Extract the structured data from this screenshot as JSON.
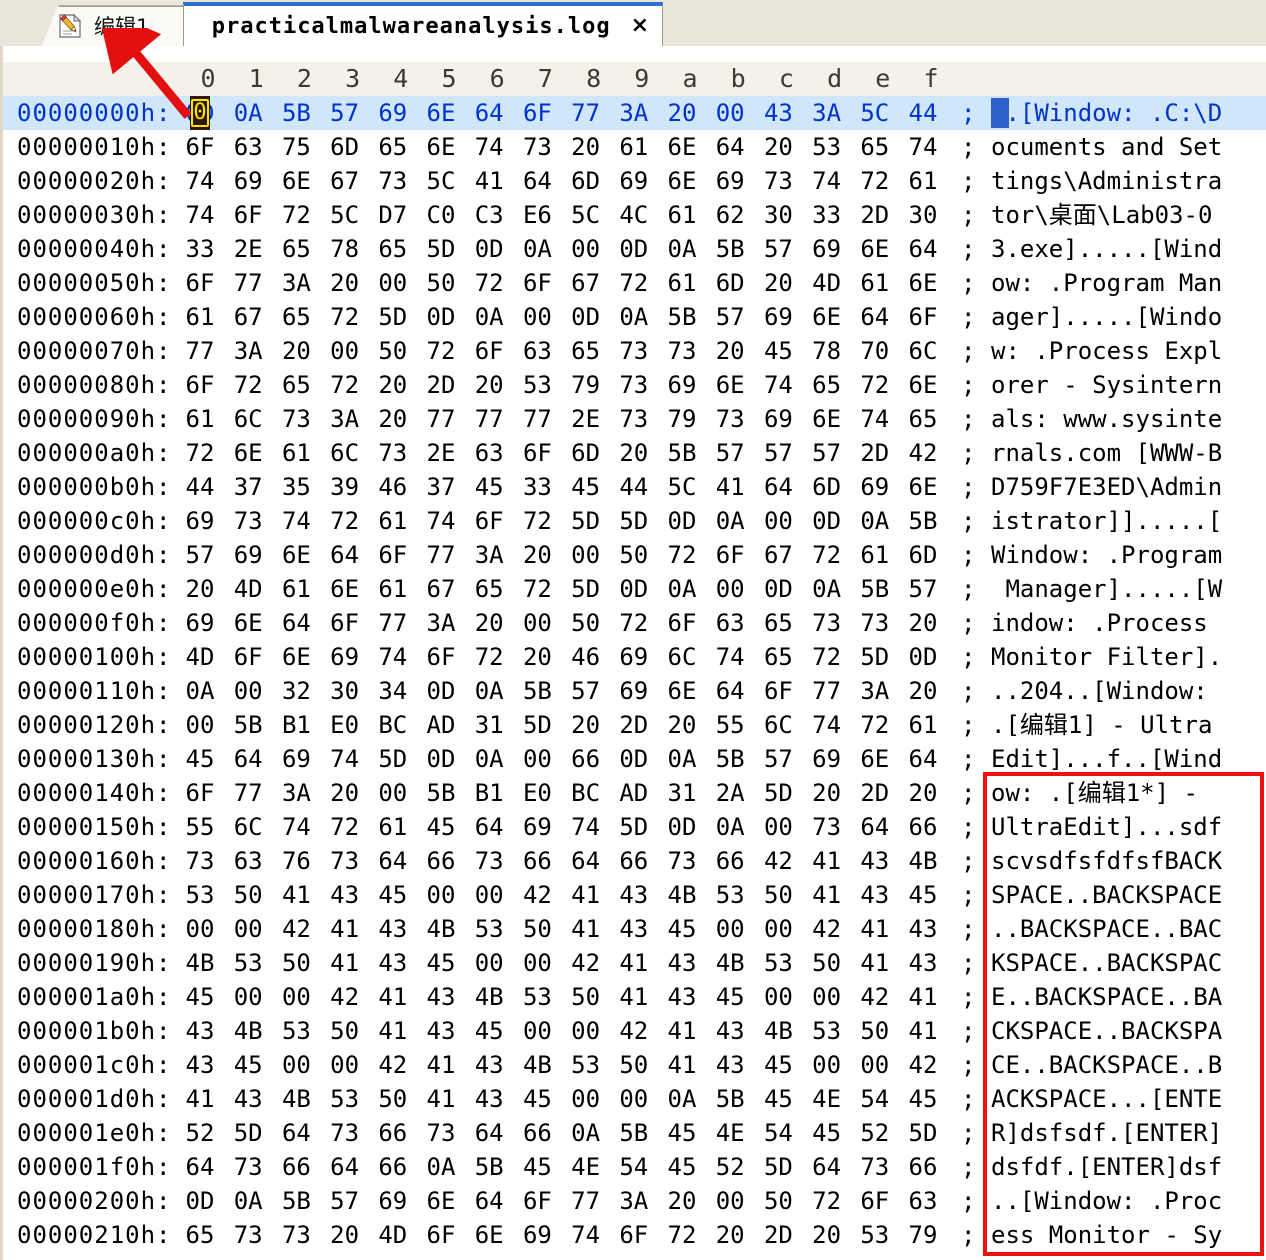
{
  "window": {
    "app": "UltraEdit hex view"
  },
  "tabs": [
    {
      "label": "编辑1",
      "icon": "document-pencil-icon",
      "active": false,
      "closable": false
    },
    {
      "label": "practicalmalwareanalysis.log",
      "icon": "none",
      "active": true,
      "closable": true,
      "close_label": "×"
    }
  ],
  "column_headers": [
    "0",
    "1",
    "2",
    "3",
    "4",
    "5",
    "6",
    "7",
    "8",
    "9",
    "a",
    "b",
    "c",
    "d",
    "e",
    "f"
  ],
  "separator": ";",
  "cursor": {
    "row": 0,
    "col": 0,
    "char": "0",
    "block_color": "#2c1a0a",
    "outline_color": "#ffe000"
  },
  "selection": {
    "ascii_row": 0,
    "ascii_col": 0,
    "color": "#2f60c8"
  },
  "annotations": {
    "arrow_color": "#e31010",
    "box_color": "#f01010",
    "arrow_target": "编辑1 tab",
    "box_target": "ascii column rows 0x140-0x210"
  },
  "colors": {
    "selected_row_bg": "#cfe6fb",
    "selected_row_fg": "#0033cc",
    "header_bg": "#f4f1e8",
    "tab_active_accent": "#2f6fd0"
  },
  "rows": [
    {
      "offset": "00000000h:",
      "bytes": [
        "0D",
        "0A",
        "5B",
        "57",
        "69",
        "6E",
        "64",
        "6F",
        "77",
        "3A",
        "20",
        "00",
        "43",
        "3A",
        "5C",
        "44"
      ],
      "ascii": "..[Window: .C:\\D",
      "selected": true
    },
    {
      "offset": "00000010h:",
      "bytes": [
        "6F",
        "63",
        "75",
        "6D",
        "65",
        "6E",
        "74",
        "73",
        "20",
        "61",
        "6E",
        "64",
        "20",
        "53",
        "65",
        "74"
      ],
      "ascii": "ocuments and Set",
      "selected": false
    },
    {
      "offset": "00000020h:",
      "bytes": [
        "74",
        "69",
        "6E",
        "67",
        "73",
        "5C",
        "41",
        "64",
        "6D",
        "69",
        "6E",
        "69",
        "73",
        "74",
        "72",
        "61"
      ],
      "ascii": "tings\\Administra",
      "selected": false
    },
    {
      "offset": "00000030h:",
      "bytes": [
        "74",
        "6F",
        "72",
        "5C",
        "D7",
        "C0",
        "C3",
        "E6",
        "5C",
        "4C",
        "61",
        "62",
        "30",
        "33",
        "2D",
        "30"
      ],
      "ascii": "tor\\桌面\\Lab03-0",
      "selected": false
    },
    {
      "offset": "00000040h:",
      "bytes": [
        "33",
        "2E",
        "65",
        "78",
        "65",
        "5D",
        "0D",
        "0A",
        "00",
        "0D",
        "0A",
        "5B",
        "57",
        "69",
        "6E",
        "64"
      ],
      "ascii": "3.exe].....[Wind",
      "selected": false
    },
    {
      "offset": "00000050h:",
      "bytes": [
        "6F",
        "77",
        "3A",
        "20",
        "00",
        "50",
        "72",
        "6F",
        "67",
        "72",
        "61",
        "6D",
        "20",
        "4D",
        "61",
        "6E"
      ],
      "ascii": "ow: .Program Man",
      "selected": false
    },
    {
      "offset": "00000060h:",
      "bytes": [
        "61",
        "67",
        "65",
        "72",
        "5D",
        "0D",
        "0A",
        "00",
        "0D",
        "0A",
        "5B",
        "57",
        "69",
        "6E",
        "64",
        "6F"
      ],
      "ascii": "ager].....[Windo",
      "selected": false
    },
    {
      "offset": "00000070h:",
      "bytes": [
        "77",
        "3A",
        "20",
        "00",
        "50",
        "72",
        "6F",
        "63",
        "65",
        "73",
        "73",
        "20",
        "45",
        "78",
        "70",
        "6C"
      ],
      "ascii": "w: .Process Expl",
      "selected": false
    },
    {
      "offset": "00000080h:",
      "bytes": [
        "6F",
        "72",
        "65",
        "72",
        "20",
        "2D",
        "20",
        "53",
        "79",
        "73",
        "69",
        "6E",
        "74",
        "65",
        "72",
        "6E"
      ],
      "ascii": "orer - Sysintern",
      "selected": false
    },
    {
      "offset": "00000090h:",
      "bytes": [
        "61",
        "6C",
        "73",
        "3A",
        "20",
        "77",
        "77",
        "77",
        "2E",
        "73",
        "79",
        "73",
        "69",
        "6E",
        "74",
        "65"
      ],
      "ascii": "als: www.sysinte",
      "selected": false
    },
    {
      "offset": "000000a0h:",
      "bytes": [
        "72",
        "6E",
        "61",
        "6C",
        "73",
        "2E",
        "63",
        "6F",
        "6D",
        "20",
        "5B",
        "57",
        "57",
        "57",
        "2D",
        "42"
      ],
      "ascii": "rnals.com [WWW-B",
      "selected": false
    },
    {
      "offset": "000000b0h:",
      "bytes": [
        "44",
        "37",
        "35",
        "39",
        "46",
        "37",
        "45",
        "33",
        "45",
        "44",
        "5C",
        "41",
        "64",
        "6D",
        "69",
        "6E"
      ],
      "ascii": "D759F7E3ED\\Admin",
      "selected": false
    },
    {
      "offset": "000000c0h:",
      "bytes": [
        "69",
        "73",
        "74",
        "72",
        "61",
        "74",
        "6F",
        "72",
        "5D",
        "5D",
        "0D",
        "0A",
        "00",
        "0D",
        "0A",
        "5B"
      ],
      "ascii": "istrator]].....[",
      "selected": false
    },
    {
      "offset": "000000d0h:",
      "bytes": [
        "57",
        "69",
        "6E",
        "64",
        "6F",
        "77",
        "3A",
        "20",
        "00",
        "50",
        "72",
        "6F",
        "67",
        "72",
        "61",
        "6D"
      ],
      "ascii": "Window: .Program",
      "selected": false
    },
    {
      "offset": "000000e0h:",
      "bytes": [
        "20",
        "4D",
        "61",
        "6E",
        "61",
        "67",
        "65",
        "72",
        "5D",
        "0D",
        "0A",
        "00",
        "0D",
        "0A",
        "5B",
        "57"
      ],
      "ascii": " Manager].....[W",
      "selected": false
    },
    {
      "offset": "000000f0h:",
      "bytes": [
        "69",
        "6E",
        "64",
        "6F",
        "77",
        "3A",
        "20",
        "00",
        "50",
        "72",
        "6F",
        "63",
        "65",
        "73",
        "73",
        "20"
      ],
      "ascii": "indow: .Process ",
      "selected": false
    },
    {
      "offset": "00000100h:",
      "bytes": [
        "4D",
        "6F",
        "6E",
        "69",
        "74",
        "6F",
        "72",
        "20",
        "46",
        "69",
        "6C",
        "74",
        "65",
        "72",
        "5D",
        "0D"
      ],
      "ascii": "Monitor Filter].",
      "selected": false
    },
    {
      "offset": "00000110h:",
      "bytes": [
        "0A",
        "00",
        "32",
        "30",
        "34",
        "0D",
        "0A",
        "5B",
        "57",
        "69",
        "6E",
        "64",
        "6F",
        "77",
        "3A",
        "20"
      ],
      "ascii": "..204..[Window: ",
      "selected": false
    },
    {
      "offset": "00000120h:",
      "bytes": [
        "00",
        "5B",
        "B1",
        "E0",
        "BC",
        "AD",
        "31",
        "5D",
        "20",
        "2D",
        "20",
        "55",
        "6C",
        "74",
        "72",
        "61"
      ],
      "ascii": ".[编辑1] - Ultra",
      "selected": false
    },
    {
      "offset": "00000130h:",
      "bytes": [
        "45",
        "64",
        "69",
        "74",
        "5D",
        "0D",
        "0A",
        "00",
        "66",
        "0D",
        "0A",
        "5B",
        "57",
        "69",
        "6E",
        "64"
      ],
      "ascii": "Edit]...f..[Wind",
      "selected": false
    },
    {
      "offset": "00000140h:",
      "bytes": [
        "6F",
        "77",
        "3A",
        "20",
        "00",
        "5B",
        "B1",
        "E0",
        "BC",
        "AD",
        "31",
        "2A",
        "5D",
        "20",
        "2D",
        "20"
      ],
      "ascii": "ow: .[编辑1*] - ",
      "selected": false
    },
    {
      "offset": "00000150h:",
      "bytes": [
        "55",
        "6C",
        "74",
        "72",
        "61",
        "45",
        "64",
        "69",
        "74",
        "5D",
        "0D",
        "0A",
        "00",
        "73",
        "64",
        "66"
      ],
      "ascii": "UltraEdit]...sdf",
      "selected": false
    },
    {
      "offset": "00000160h:",
      "bytes": [
        "73",
        "63",
        "76",
        "73",
        "64",
        "66",
        "73",
        "66",
        "64",
        "66",
        "73",
        "66",
        "42",
        "41",
        "43",
        "4B"
      ],
      "ascii": "scvsdfsfdfsfBACK",
      "selected": false
    },
    {
      "offset": "00000170h:",
      "bytes": [
        "53",
        "50",
        "41",
        "43",
        "45",
        "00",
        "00",
        "42",
        "41",
        "43",
        "4B",
        "53",
        "50",
        "41",
        "43",
        "45"
      ],
      "ascii": "SPACE..BACKSPACE",
      "selected": false
    },
    {
      "offset": "00000180h:",
      "bytes": [
        "00",
        "00",
        "42",
        "41",
        "43",
        "4B",
        "53",
        "50",
        "41",
        "43",
        "45",
        "00",
        "00",
        "42",
        "41",
        "43"
      ],
      "ascii": "..BACKSPACE..BAC",
      "selected": false
    },
    {
      "offset": "00000190h:",
      "bytes": [
        "4B",
        "53",
        "50",
        "41",
        "43",
        "45",
        "00",
        "00",
        "42",
        "41",
        "43",
        "4B",
        "53",
        "50",
        "41",
        "43"
      ],
      "ascii": "KSPACE..BACKSPAC",
      "selected": false
    },
    {
      "offset": "000001a0h:",
      "bytes": [
        "45",
        "00",
        "00",
        "42",
        "41",
        "43",
        "4B",
        "53",
        "50",
        "41",
        "43",
        "45",
        "00",
        "00",
        "42",
        "41"
      ],
      "ascii": "E..BACKSPACE..BA",
      "selected": false
    },
    {
      "offset": "000001b0h:",
      "bytes": [
        "43",
        "4B",
        "53",
        "50",
        "41",
        "43",
        "45",
        "00",
        "00",
        "42",
        "41",
        "43",
        "4B",
        "53",
        "50",
        "41"
      ],
      "ascii": "CKSPACE..BACKSPA",
      "selected": false
    },
    {
      "offset": "000001c0h:",
      "bytes": [
        "43",
        "45",
        "00",
        "00",
        "42",
        "41",
        "43",
        "4B",
        "53",
        "50",
        "41",
        "43",
        "45",
        "00",
        "00",
        "42"
      ],
      "ascii": "CE..BACKSPACE..B",
      "selected": false
    },
    {
      "offset": "000001d0h:",
      "bytes": [
        "41",
        "43",
        "4B",
        "53",
        "50",
        "41",
        "43",
        "45",
        "00",
        "00",
        "0A",
        "5B",
        "45",
        "4E",
        "54",
        "45"
      ],
      "ascii": "ACKSPACE...[ENTE",
      "selected": false
    },
    {
      "offset": "000001e0h:",
      "bytes": [
        "52",
        "5D",
        "64",
        "73",
        "66",
        "73",
        "64",
        "66",
        "0A",
        "5B",
        "45",
        "4E",
        "54",
        "45",
        "52",
        "5D"
      ],
      "ascii": "R]dsfsdf.[ENTER]",
      "selected": false
    },
    {
      "offset": "000001f0h:",
      "bytes": [
        "64",
        "73",
        "66",
        "64",
        "66",
        "0A",
        "5B",
        "45",
        "4E",
        "54",
        "45",
        "52",
        "5D",
        "64",
        "73",
        "66"
      ],
      "ascii": "dsfdf.[ENTER]dsf",
      "selected": false
    },
    {
      "offset": "00000200h:",
      "bytes": [
        "0D",
        "0A",
        "5B",
        "57",
        "69",
        "6E",
        "64",
        "6F",
        "77",
        "3A",
        "20",
        "00",
        "50",
        "72",
        "6F",
        "63"
      ],
      "ascii": "..[Window: .Proc",
      "selected": false
    },
    {
      "offset": "00000210h:",
      "bytes": [
        "65",
        "73",
        "73",
        "20",
        "4D",
        "6F",
        "6E",
        "69",
        "74",
        "6F",
        "72",
        "20",
        "2D",
        "20",
        "53",
        "79"
      ],
      "ascii": "ess Monitor - Sy",
      "selected": false
    }
  ]
}
